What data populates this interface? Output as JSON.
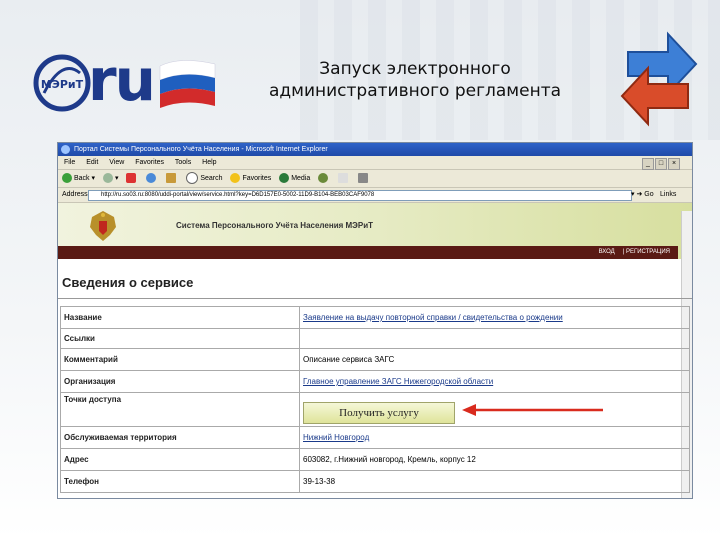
{
  "slide": {
    "logo_text": "ru",
    "logo_seal": "МЭРиТ",
    "title_line1": "Запуск электронного",
    "title_line2": "административного регламента"
  },
  "browser": {
    "window_title": "Портал Системы Персонального Учёта Населения - Microsoft Internet Explorer",
    "menu": [
      "File",
      "Edit",
      "View",
      "Favorites",
      "Tools",
      "Help"
    ],
    "toolbar": {
      "back": "Back",
      "search": "Search",
      "favorites": "Favorites",
      "media": "Media"
    },
    "address_label": "Address",
    "address_value": "http://ru.so03.ru:8080/uddi-portal/view/service.html?key=D6D157E0-5002-11D9-B104-BEB03CAF9078",
    "go_label": "Go",
    "links_label": "Links",
    "win_buttons": [
      "_",
      "□",
      "×"
    ]
  },
  "portal": {
    "title": "Система Персонального Учёта Населения МЭРиТ",
    "nav": [
      "ВХОД",
      "РЕГИСТРАЦИЯ"
    ]
  },
  "service": {
    "heading": "Сведения о сервисе",
    "rows": [
      {
        "label": "Название",
        "value": "Заявление на выдачу повторной справки / свидетельства о рождении",
        "link": true
      },
      {
        "label": "Ссылки",
        "value": "",
        "link": false
      },
      {
        "label": "Комментарий",
        "value": "Описание сервиса ЗАГС",
        "link": false
      },
      {
        "label": "Организация",
        "value": "Главное управление ЗАГС Нижегородской области",
        "link": true
      },
      {
        "label": "Точки доступа",
        "value": "",
        "link": false
      },
      {
        "label": "Обслуживаемая территория",
        "value": "Нижний Новгород",
        "link": true
      },
      {
        "label": "Адрес",
        "value": "603082, г.Нижний новгород, Кремль, корпус 12",
        "link": false
      },
      {
        "label": "Телефон",
        "value": "39-13-38",
        "link": false
      }
    ],
    "get_service_button": "Получить услугу"
  },
  "colors": {
    "accent_blue": "#1e3a8a",
    "flag_white": "#ffffff",
    "flag_blue": "#1f5fbf",
    "flag_red": "#d22b2b",
    "arrow_red": "#d92b1e",
    "nav_bar": "#5a1a14"
  }
}
